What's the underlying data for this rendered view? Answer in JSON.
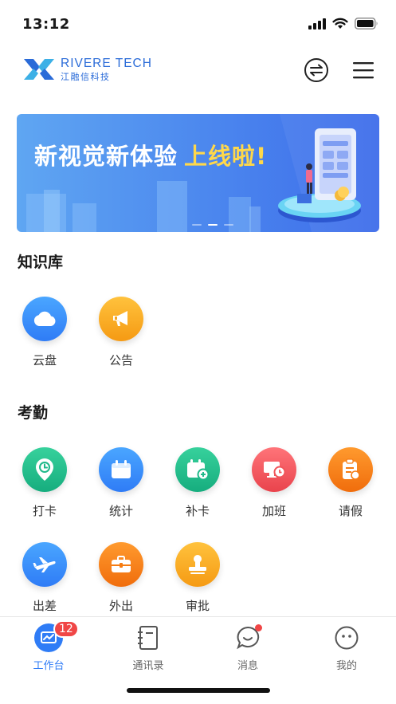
{
  "status_bar": {
    "time": "13:12"
  },
  "header": {
    "logo_en": "RIVERE TECH",
    "logo_cn": "江融信科技",
    "switch_icon": "switch-arrows-icon",
    "menu_icon": "hamburger-menu-icon"
  },
  "banner": {
    "text_main": "新视觉新体验",
    "text_highlight": "上线啦!"
  },
  "knowledge": {
    "title": "知识库",
    "items": [
      {
        "label": "云盘",
        "icon": "cloud-icon",
        "color": "#2f8cf5"
      },
      {
        "label": "公告",
        "icon": "megaphone-icon",
        "color": "#f7a51c"
      }
    ]
  },
  "attendance": {
    "title": "考勤",
    "items": [
      {
        "label": "打卡",
        "icon": "location-clock-icon",
        "color": "#1fb98a"
      },
      {
        "label": "统计",
        "icon": "calendar-icon",
        "color": "#2f8cf5"
      },
      {
        "label": "补卡",
        "icon": "calendar-add-icon",
        "color": "#1fb98a"
      },
      {
        "label": "加班",
        "icon": "monitor-clock-icon",
        "color": "#f0555a"
      },
      {
        "label": "请假",
        "icon": "clipboard-icon",
        "color": "#f67c12"
      },
      {
        "label": "出差",
        "icon": "airplane-icon",
        "color": "#2f8cf5"
      },
      {
        "label": "外出",
        "icon": "briefcase-icon",
        "color": "#f67c12"
      },
      {
        "label": "审批",
        "icon": "stamp-icon",
        "color": "#f7a51c"
      }
    ]
  },
  "tabbar": {
    "items": [
      {
        "label": "工作台",
        "icon": "workbench-icon",
        "badge": "12",
        "active": true
      },
      {
        "label": "通讯录",
        "icon": "contacts-book-icon"
      },
      {
        "label": "消息",
        "icon": "message-bubble-icon"
      },
      {
        "label": "我的",
        "icon": "profile-face-icon"
      }
    ]
  }
}
